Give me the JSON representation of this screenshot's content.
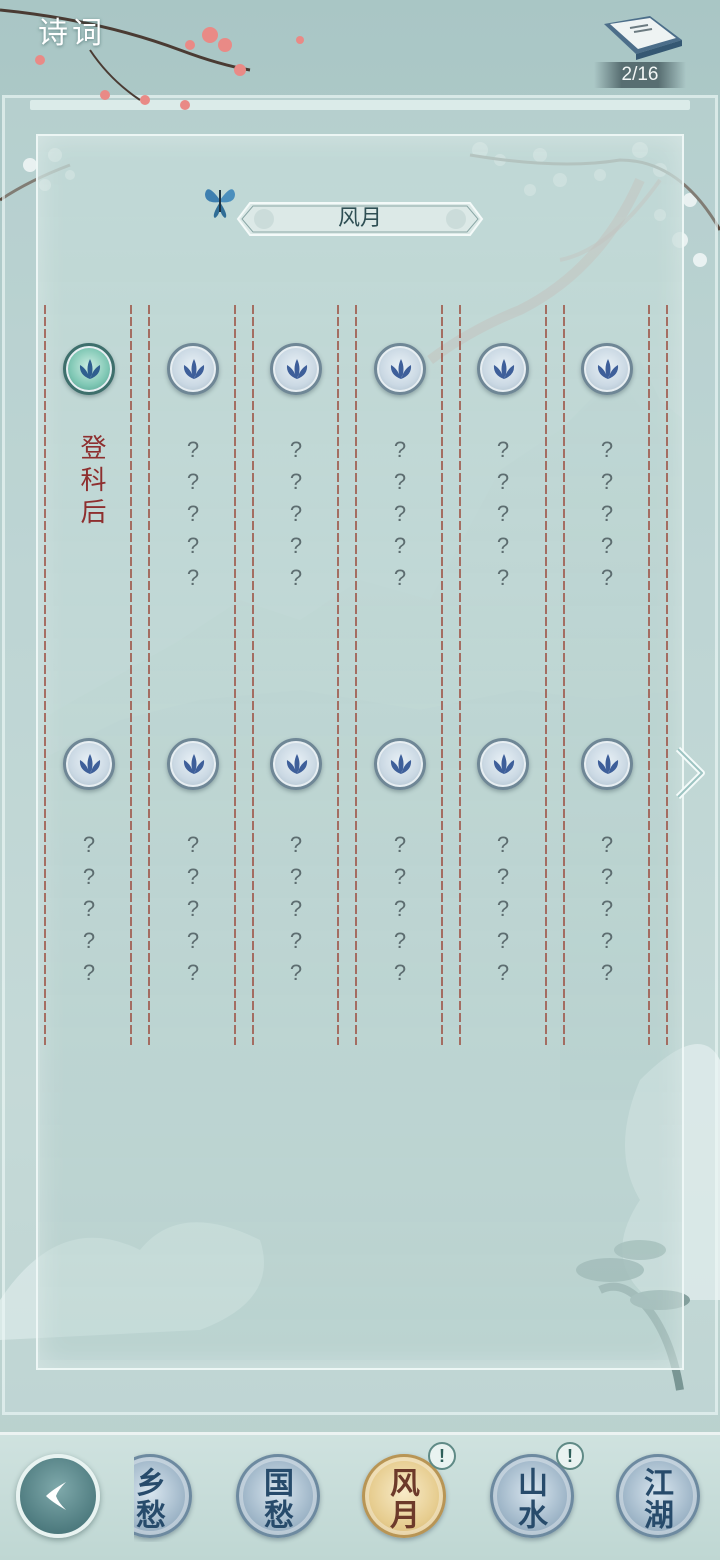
{
  "header": {
    "title": "诗词",
    "progress": "2/16"
  },
  "chapter": {
    "name": "风月"
  },
  "rows": [
    {
      "poems": [
        {
          "title": "登科后",
          "unlocked": true
        },
        {
          "marks": [
            "?",
            "?",
            "?",
            "?",
            "?"
          ]
        },
        {
          "marks": [
            "?",
            "?",
            "?",
            "?",
            "?"
          ]
        },
        {
          "marks": [
            "?",
            "?",
            "?",
            "?",
            "?"
          ]
        },
        {
          "marks": [
            "?",
            "?",
            "?",
            "?",
            "?"
          ]
        },
        {
          "marks": [
            "?",
            "?",
            "?",
            "?",
            "?"
          ]
        }
      ]
    },
    {
      "poems": [
        {
          "marks": [
            "?",
            "?",
            "?",
            "?",
            "?"
          ]
        },
        {
          "marks": [
            "?",
            "?",
            "?",
            "?",
            "?"
          ]
        },
        {
          "marks": [
            "?",
            "?",
            "?",
            "?",
            "?"
          ]
        },
        {
          "marks": [
            "?",
            "?",
            "?",
            "?",
            "?"
          ]
        },
        {
          "marks": [
            "?",
            "?",
            "?",
            "?",
            "?"
          ]
        },
        {
          "marks": [
            "?",
            "?",
            "?",
            "?",
            "?"
          ]
        }
      ]
    }
  ],
  "nav": {
    "tabs": [
      {
        "label": "乡愁",
        "active": false,
        "badge": ""
      },
      {
        "label": "国愁",
        "active": false,
        "badge": ""
      },
      {
        "label": "风月",
        "active": true,
        "badge": "!"
      },
      {
        "label": "山水",
        "active": false,
        "badge": "!"
      },
      {
        "label": "江湖",
        "active": false,
        "badge": ""
      }
    ]
  },
  "icons": {
    "back": "back-chevron-icon",
    "next": "next-arrow-icon",
    "medal": "lotus-medal-icon",
    "book": "poetry-book-icon",
    "butterfly": "butterfly-icon"
  },
  "colors": {
    "poem_title": "#8e2f2f",
    "rule": "#9b4a3c",
    "active_tab": "#e6cc8e",
    "inactive_tab": "#9fb6c8"
  }
}
